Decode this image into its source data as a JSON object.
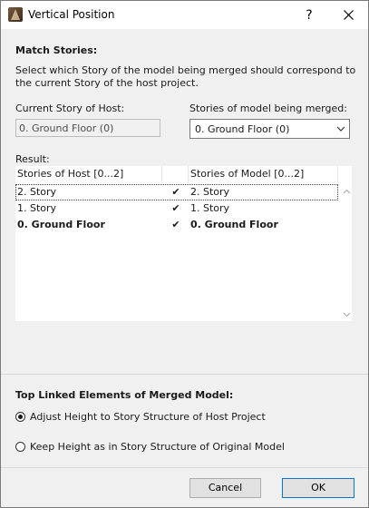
{
  "window": {
    "title": "Vertical Position",
    "help_label": "?",
    "close_label": "✕"
  },
  "match": {
    "title": "Match Stories:",
    "description": "Select which Story of the model being merged should correspond to the current Story of the host project.",
    "current_host_label": "Current Story of Host:",
    "current_host_value": "0. Ground Floor (0)",
    "merged_label": "Stories of model being merged:",
    "merged_selected": "0. Ground Floor (0)"
  },
  "result": {
    "label": "Result:",
    "columns": {
      "host": "Stories of Host [0...2]",
      "check": "",
      "model": "Stories of Model [0...2]"
    },
    "rows": [
      {
        "host": "2. Story",
        "check": "✔",
        "model": "2. Story",
        "bold": false,
        "selected": true
      },
      {
        "host": "1. Story",
        "check": "✔",
        "model": "1. Story",
        "bold": false,
        "selected": false
      },
      {
        "host": "0. Ground Floor",
        "check": "✔",
        "model": "0. Ground Floor",
        "bold": true,
        "selected": false
      }
    ]
  },
  "linked": {
    "title": "Top Linked Elements of Merged Model:",
    "options": [
      {
        "label": "Adjust Height to Story Structure of Host Project",
        "checked": true
      },
      {
        "label": "Keep Height as in Story Structure of Original Model",
        "checked": false
      }
    ]
  },
  "footer": {
    "cancel_label": "Cancel",
    "ok_label": "OK"
  }
}
